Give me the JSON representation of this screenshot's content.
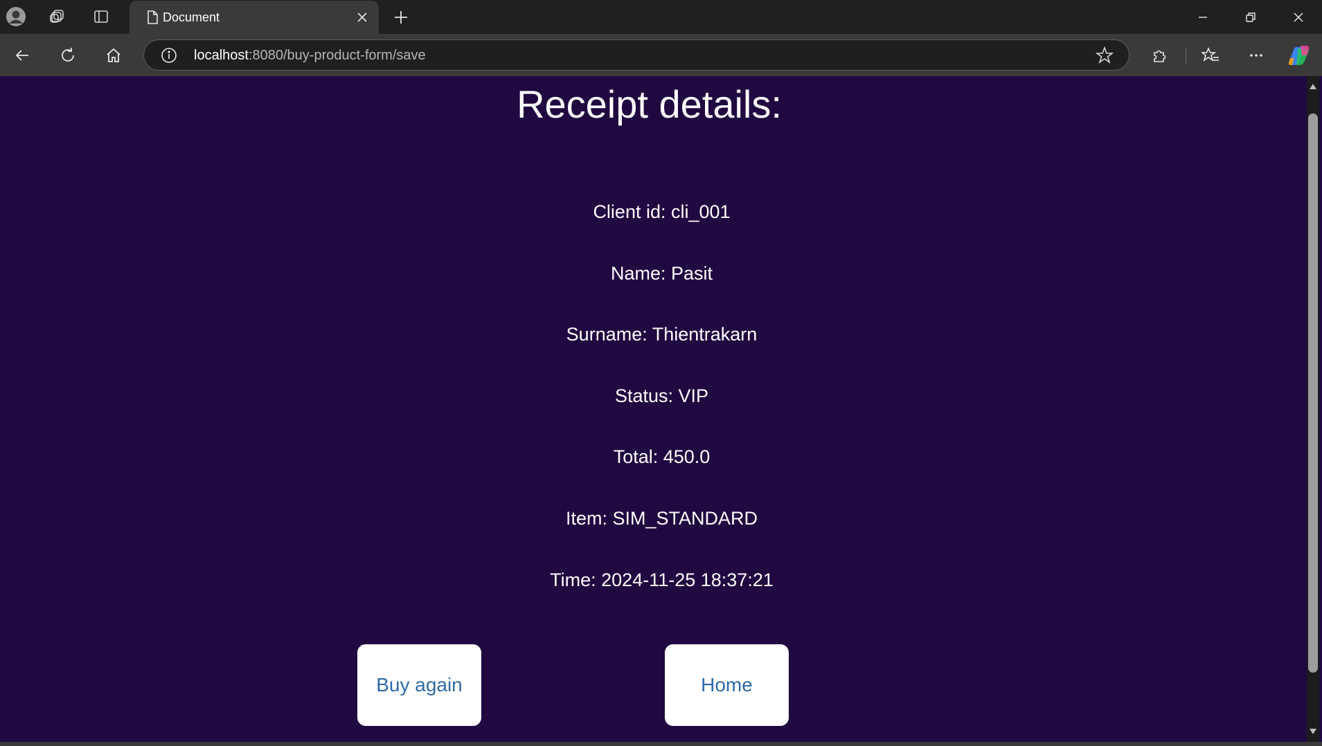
{
  "browser": {
    "tab": {
      "title": "Document"
    },
    "address": {
      "host": "localhost",
      "rest": ":8080/buy-product-form/save"
    }
  },
  "icons": {
    "profile": "profile-avatar-icon",
    "workspaces": "workspaces-icon",
    "tab_actions": "tab-actions-icon",
    "document": "document-icon",
    "close_tab": "close-icon",
    "new_tab": "plus-icon",
    "minimize": "minimize-icon",
    "restore": "restore-icon",
    "close_window": "close-icon",
    "back": "back-arrow-icon",
    "refresh": "refresh-icon",
    "home": "home-icon",
    "site_info": "info-icon",
    "favorite": "star-icon",
    "extensions": "puzzle-icon",
    "favorites": "favorites-icon",
    "more": "ellipsis-icon",
    "copilot": "copilot-icon"
  },
  "page": {
    "heading": "Receipt details:",
    "details": [
      "Client id: cli_001",
      "Name: Pasit",
      "Surname: Thientrakarn",
      "Status: VIP",
      "Total: 450.0",
      "Item: SIM_STANDARD",
      "Time: 2024-11-25 18:37:21"
    ],
    "buttons": {
      "buy_again": "Buy again",
      "home": "Home"
    }
  },
  "colors": {
    "page_background": "#200840",
    "text": "#ffffff",
    "button_background": "#ffffff",
    "button_text": "#2f6aa8",
    "chrome_dark": "#202020",
    "chrome_toolbar": "#3a3a3a"
  }
}
